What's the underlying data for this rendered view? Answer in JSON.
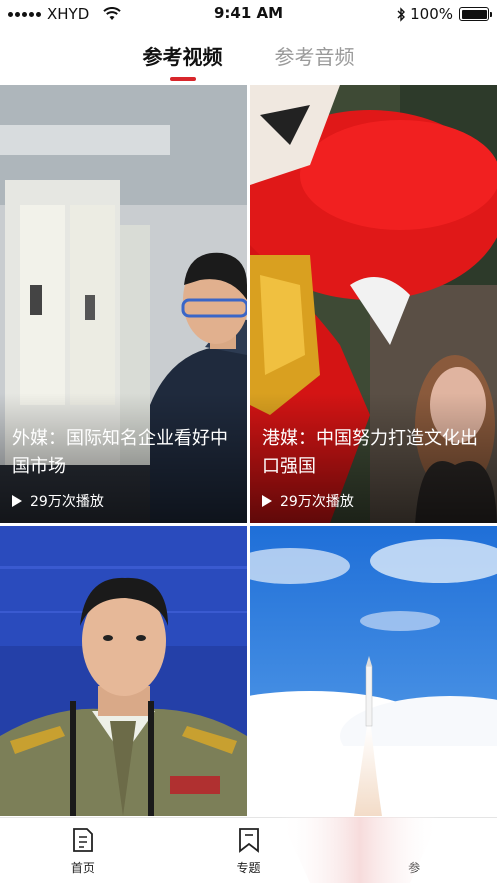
{
  "status_bar": {
    "carrier": "XHYD",
    "time": "9:41 AM",
    "battery_percent": "100%",
    "battery_level": 1.0
  },
  "top_tabs": [
    {
      "label": "参考视频",
      "active": true
    },
    {
      "label": "参考音频",
      "active": false
    }
  ],
  "videos": [
    {
      "title": "外媒：国际知名企业看好中国市场",
      "plays": "29万次播放",
      "scene": "engineer-at-machine"
    },
    {
      "title": "港媒：中国努力打造文化出口强国",
      "plays": "29万次播放",
      "scene": "lion-dance"
    },
    {
      "title": "",
      "plays": "",
      "scene": "press-conference-officer"
    },
    {
      "title": "",
      "plays": "",
      "scene": "rocket-launch"
    }
  ],
  "tab_bar": [
    {
      "label": "首页",
      "icon": "document-icon"
    },
    {
      "label": "专题",
      "icon": "bookmark-icon"
    },
    {
      "label": "参",
      "icon": ""
    }
  ],
  "colors": {
    "accent": "#d8262b",
    "inactive_tab": "#9a9a9a"
  }
}
